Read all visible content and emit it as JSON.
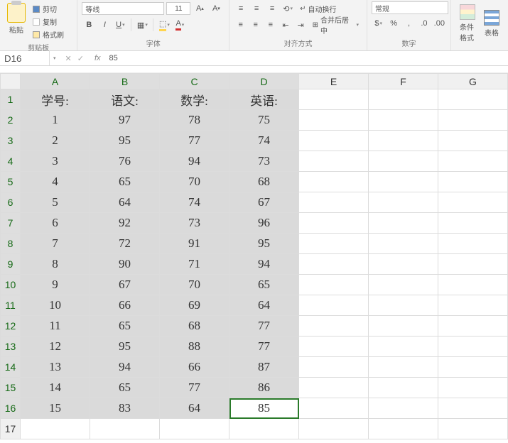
{
  "ribbon": {
    "clipboard": {
      "paste": "粘贴",
      "cut": "剪切",
      "copy": "复制",
      "format_painter": "格式刷",
      "group": "剪贴板"
    },
    "font": {
      "name": "等线",
      "size": "11",
      "group": "字体"
    },
    "alignment": {
      "wrap": "自动换行",
      "merge": "合并后居中",
      "group": "对齐方式"
    },
    "number": {
      "format": "常规",
      "group": "数字"
    },
    "styles": {
      "cond": "条件格式",
      "table": "表格"
    }
  },
  "formula_bar": {
    "name_box_ref": "D16",
    "fx_label": "fx",
    "formula": "85",
    "cancel": "✕",
    "accept": "✓",
    "dropdown": "▾"
  },
  "columns_all": [
    "A",
    "B",
    "C",
    "D",
    "E",
    "F",
    "G"
  ],
  "selected_cols": [
    "A",
    "B",
    "C",
    "D"
  ],
  "headers": [
    "学号:",
    "语文:",
    "数学:",
    "英语:"
  ],
  "rows": [
    [
      1,
      97,
      78,
      75
    ],
    [
      2,
      95,
      77,
      74
    ],
    [
      3,
      76,
      94,
      73
    ],
    [
      4,
      65,
      70,
      68
    ],
    [
      5,
      64,
      74,
      67
    ],
    [
      6,
      92,
      73,
      96
    ],
    [
      7,
      72,
      91,
      95
    ],
    [
      8,
      90,
      71,
      94
    ],
    [
      9,
      67,
      70,
      65
    ],
    [
      10,
      66,
      69,
      64
    ],
    [
      11,
      65,
      68,
      77
    ],
    [
      12,
      95,
      88,
      77
    ],
    [
      13,
      94,
      66,
      87
    ],
    [
      14,
      65,
      77,
      86
    ],
    [
      15,
      83,
      64,
      85
    ]
  ],
  "active_cell": {
    "row": 16,
    "col": "D"
  },
  "extra_empty_rows": [
    17
  ],
  "chart_data": {
    "type": "table",
    "title": "",
    "columns": [
      "学号",
      "语文",
      "数学",
      "英语"
    ],
    "series": [
      {
        "name": "学号",
        "values": [
          1,
          2,
          3,
          4,
          5,
          6,
          7,
          8,
          9,
          10,
          11,
          12,
          13,
          14,
          15
        ]
      },
      {
        "name": "语文",
        "values": [
          97,
          95,
          76,
          65,
          64,
          92,
          72,
          90,
          67,
          66,
          65,
          95,
          94,
          65,
          83
        ]
      },
      {
        "name": "数学",
        "values": [
          78,
          77,
          94,
          70,
          74,
          73,
          91,
          71,
          70,
          69,
          68,
          88,
          66,
          77,
          64
        ]
      },
      {
        "name": "英语",
        "values": [
          75,
          74,
          73,
          68,
          67,
          96,
          95,
          94,
          65,
          64,
          77,
          77,
          87,
          86,
          85
        ]
      }
    ]
  }
}
